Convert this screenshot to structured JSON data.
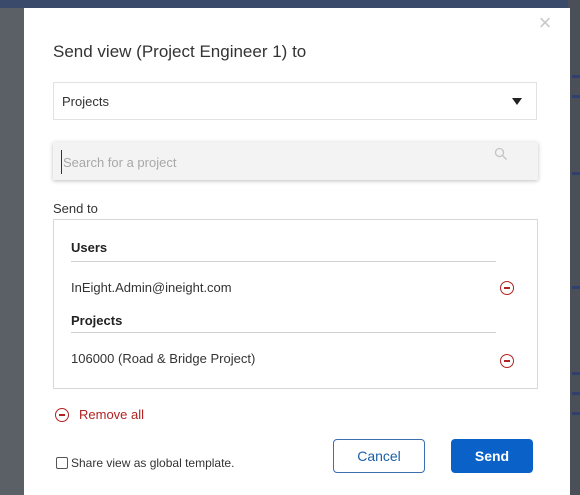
{
  "dialog": {
    "title": "Send view (Project Engineer 1) to",
    "close_glyph": "×"
  },
  "target_select": {
    "selected": "Projects"
  },
  "search": {
    "placeholder": "Search for a project",
    "value": ""
  },
  "send_to": {
    "label": "Send to",
    "groups": [
      {
        "heading": "Users",
        "entries": [
          "InEight.Admin@ineight.com"
        ]
      },
      {
        "heading": "Projects",
        "entries": [
          "106000 (Road & Bridge Project)"
        ]
      }
    ]
  },
  "remove_all_label": "Remove all",
  "share_template": {
    "label": "Share view as global template.",
    "checked": false
  },
  "buttons": {
    "cancel": "Cancel",
    "send": "Send"
  },
  "colors": {
    "primary": "#0a62c9",
    "danger": "#b22222"
  }
}
